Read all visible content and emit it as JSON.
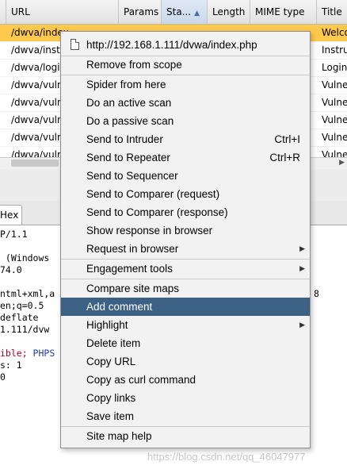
{
  "table": {
    "columns": [
      "URL",
      "Params",
      "Sta...",
      "Length",
      "MIME type",
      "Title"
    ],
    "sort_indicator": "▲",
    "rows": [
      {
        "url": "/dwva/index",
        "title": "Welco"
      },
      {
        "url": "/dwva/instru",
        "title": "Instru"
      },
      {
        "url": "/dwva/login",
        "title": "Login"
      },
      {
        "url": "/dwva/vulne",
        "title": "Vulne"
      },
      {
        "url": "/dwva/vulne",
        "title": "Vulne"
      },
      {
        "url": "/dwva/vulne",
        "title": "Vulne"
      },
      {
        "url": "/dwva/vulne",
        "title": "Vulne"
      },
      {
        "url": "/dwva/vulne",
        "title": "Vulne"
      }
    ]
  },
  "tabs": {
    "hex": "Hex"
  },
  "raw": {
    "lines": [
      "P/1.1",
      "",
      " (Windows",
      "74.0",
      "",
      "ntml+xml,a",
      "en;q=0.5",
      "deflate",
      "1.111/dvw",
      ""
    ],
    "cookie_prefix": "ible; ",
    "cookie_name": "PHPS",
    "line_s": "s: 1",
    "line_0": "0",
    "tail": "8"
  },
  "menu": {
    "header": "http://192.168.1.111/dvwa/index.php",
    "items": [
      {
        "label": "Remove from scope"
      },
      {
        "label": "Spider from here"
      },
      {
        "label": "Do an active scan"
      },
      {
        "label": "Do a passive scan"
      },
      {
        "label": "Send to Intruder",
        "shortcut": "Ctrl+I"
      },
      {
        "label": "Send to Repeater",
        "shortcut": "Ctrl+R"
      },
      {
        "label": "Send to Sequencer"
      },
      {
        "label": "Send to Comparer (request)"
      },
      {
        "label": "Send to Comparer (response)"
      },
      {
        "label": "Show response in browser"
      },
      {
        "label": "Request in browser"
      },
      {
        "label": "Engagement tools"
      },
      {
        "label": "Compare site maps"
      },
      {
        "label": "Add comment"
      },
      {
        "label": "Highlight"
      },
      {
        "label": "Delete item"
      },
      {
        "label": "Copy URL"
      },
      {
        "label": "Copy as curl command"
      },
      {
        "label": "Copy links"
      },
      {
        "label": "Save item"
      },
      {
        "label": "Site map help"
      }
    ]
  },
  "watermark": "https://blog.csdn.net/qq_46047977",
  "colors": {
    "selected_row": "#ffc94d",
    "menu_highlight": "#3c6185"
  }
}
